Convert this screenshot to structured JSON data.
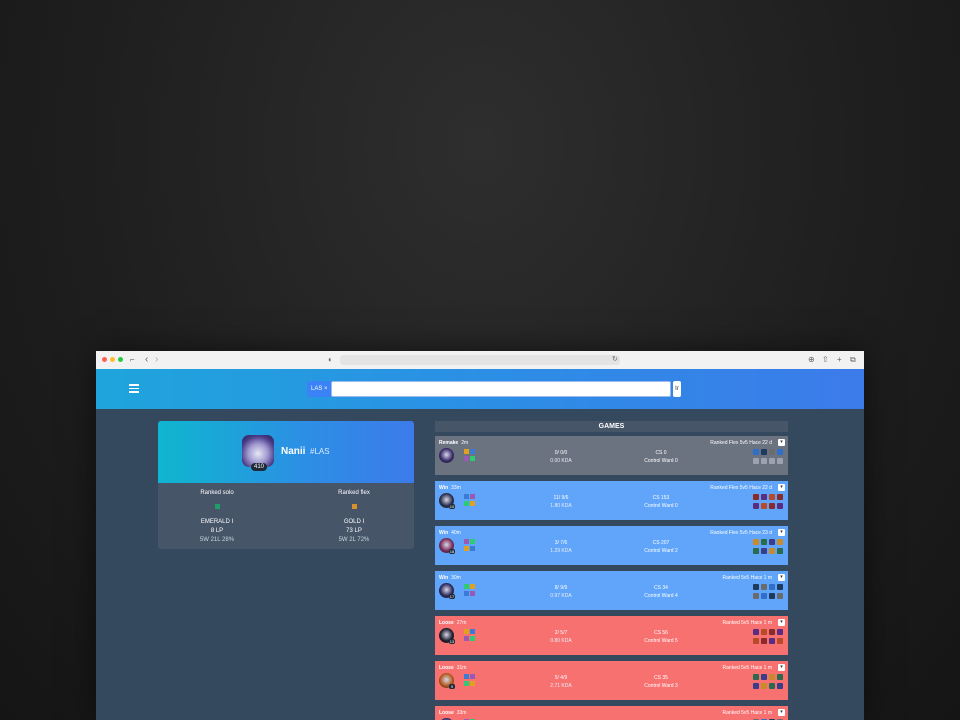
{
  "browser": {
    "nav_back": "‹",
    "nav_forward": "›",
    "sidebar_glyph": "⌐",
    "site_glyph": "◐",
    "reload_glyph": "↻",
    "toolbar_glyphs": [
      "⊕",
      "⇧",
      "+",
      "⧉"
    ]
  },
  "header": {
    "region_label": "LAS ×",
    "search_placeholder": "",
    "go_label": "Ir"
  },
  "profile": {
    "name": "Nanii",
    "tag": "#LAS",
    "level": "410",
    "ranks": [
      {
        "queue": "Ranked solo",
        "tier": "EMERALD I",
        "lp": "8 LP",
        "record": "5W 21L 28%",
        "emblem_color": "#1f9e6b"
      },
      {
        "queue": "Ranked flex",
        "tier": "GOLD I",
        "lp": "73 LP",
        "record": "5W 2L 72%",
        "emblem_color": "#d98f2a"
      }
    ]
  },
  "games": {
    "title": "GAMES",
    "expand_label": "▾",
    "colors": {
      "Remake": "#6b7280",
      "Win": "#60a5fa",
      "Loose": "#f87171"
    },
    "rows": [
      {
        "result": "Remake",
        "duration": "2m",
        "queue": "Ranked Flex 5v5",
        "ago": "Hace 22 d",
        "kda": "0/ 0/0",
        "kda_ratio": "0.00 KDA",
        "cs": "CS 0",
        "wards": "Control Ward 0",
        "level": "",
        "champ_color": "#3a2d6b"
      },
      {
        "result": "Win",
        "duration": "33m",
        "queue": "Ranked Flex 5v5",
        "ago": "Hace 22 d",
        "kda": "11/ 9/6",
        "kda_ratio": "1.80 KDA",
        "cs": "CS 153",
        "wards": "Control Ward 0",
        "level": "10",
        "champ_color": "#2a2f4f"
      },
      {
        "result": "Win",
        "duration": "40m",
        "queue": "Ranked Flex 5v5",
        "ago": "Hace 23 d",
        "kda": "3/ 7/6",
        "kda_ratio": "1.29 KDA",
        "cs": "CS 207",
        "wards": "Control Ward 2",
        "level": "18",
        "champ_color": "#7a2d5a"
      },
      {
        "result": "Win",
        "duration": "30m",
        "queue": "Ranked 5v5",
        "ago": "Hace 1 m",
        "kda": "8/ 9/9",
        "kda_ratio": "0.97 KDA",
        "cs": "CS 34",
        "wards": "Control Ward 4",
        "level": "17",
        "champ_color": "#2b2a5c"
      },
      {
        "result": "Loose",
        "duration": "27m",
        "queue": "Ranked 5v5",
        "ago": "Hace 1 m",
        "kda": "2/ 5/7",
        "kda_ratio": "0.80 KDA",
        "cs": "CS 56",
        "wards": "Control Ward 5",
        "level": "13",
        "champ_color": "#1e1e2e"
      },
      {
        "result": "Loose",
        "duration": "31m",
        "queue": "Ranked 5v5",
        "ago": "Hace 1 m",
        "kda": "5/ 4/9",
        "kda_ratio": "2.71 KDA",
        "cs": "CS 35",
        "wards": "Control Ward 3",
        "level": "9",
        "champ_color": "#b35a1f"
      },
      {
        "result": "Loose",
        "duration": "33m",
        "queue": "Ranked 5v5",
        "ago": "Hace 1 m",
        "kda": "",
        "kda_ratio": "",
        "cs": "",
        "wards": "",
        "level": "",
        "champ_color": "#3a2d6b"
      }
    ]
  }
}
